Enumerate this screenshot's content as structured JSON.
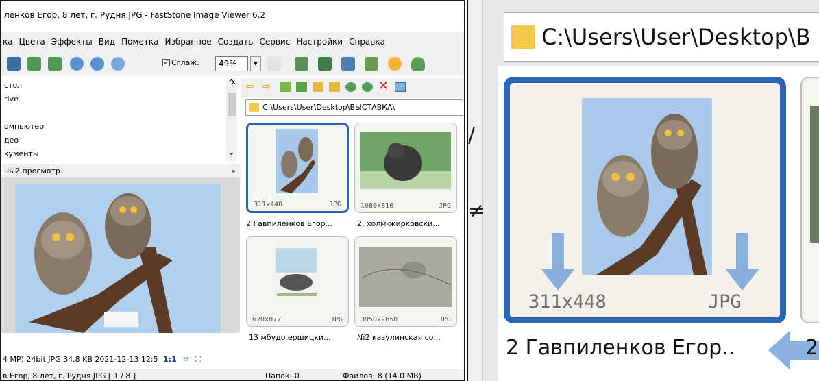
{
  "window": {
    "title": "ленков Егор, 8 лет, г. Рудня.JPG  -  FastStone Image Viewer 6.2"
  },
  "menu": [
    "ка",
    "Цвета",
    "Эффекты",
    "Вид",
    "Пометка",
    "Избранное",
    "Создать",
    "Сервис",
    "Настройки",
    "Справка"
  ],
  "toolbar": {
    "smooth_label": "Сглаж.",
    "smooth_checked": true,
    "zoom_value": "49%"
  },
  "tree": {
    "items": [
      "стол",
      "rive",
      "омпьютер",
      "део",
      "кументы"
    ]
  },
  "preview": {
    "header": "ный просмотр",
    "info": "4 MP) 24bit  JPG  34.8 KB  2021-12-13 12:5",
    "ratio": "1:1"
  },
  "status": {
    "file": "в Егор, 8 лет, г. Рудня.JPG [ 1 / 8 ]",
    "folders": "Папок: 0",
    "files": "Файлов: 8 (14.0 MB)"
  },
  "browser": {
    "path": "C:\\Users\\User\\Desktop\\ВЫСТАВКА\\",
    "thumbs": [
      {
        "dim": "311x448",
        "fmt": "JPG",
        "caption": "2 Гавпиленков Егор...",
        "selected": true
      },
      {
        "dim": "1080x810",
        "fmt": "JPG",
        "caption": "2, холм-жирковски...",
        "selected": false
      },
      {
        "dim": "620x877",
        "fmt": "JPG",
        "caption": "13 мбудо ершицки...",
        "selected": false
      },
      {
        "dim": "3950x2650",
        "fmt": "JPG",
        "caption": "№2 казулинская со...",
        "selected": false
      }
    ]
  },
  "zoomed": {
    "path": "C:\\Users\\User\\Desktop\\B",
    "dim": "311x448",
    "fmt": "JPG",
    "caption": "2 Гавпиленков Егор..",
    "caption_tail": "2"
  },
  "colors": {
    "selection": "#2d63b8",
    "arrow": "#7ea8dc",
    "folder": "#f2c94c"
  }
}
